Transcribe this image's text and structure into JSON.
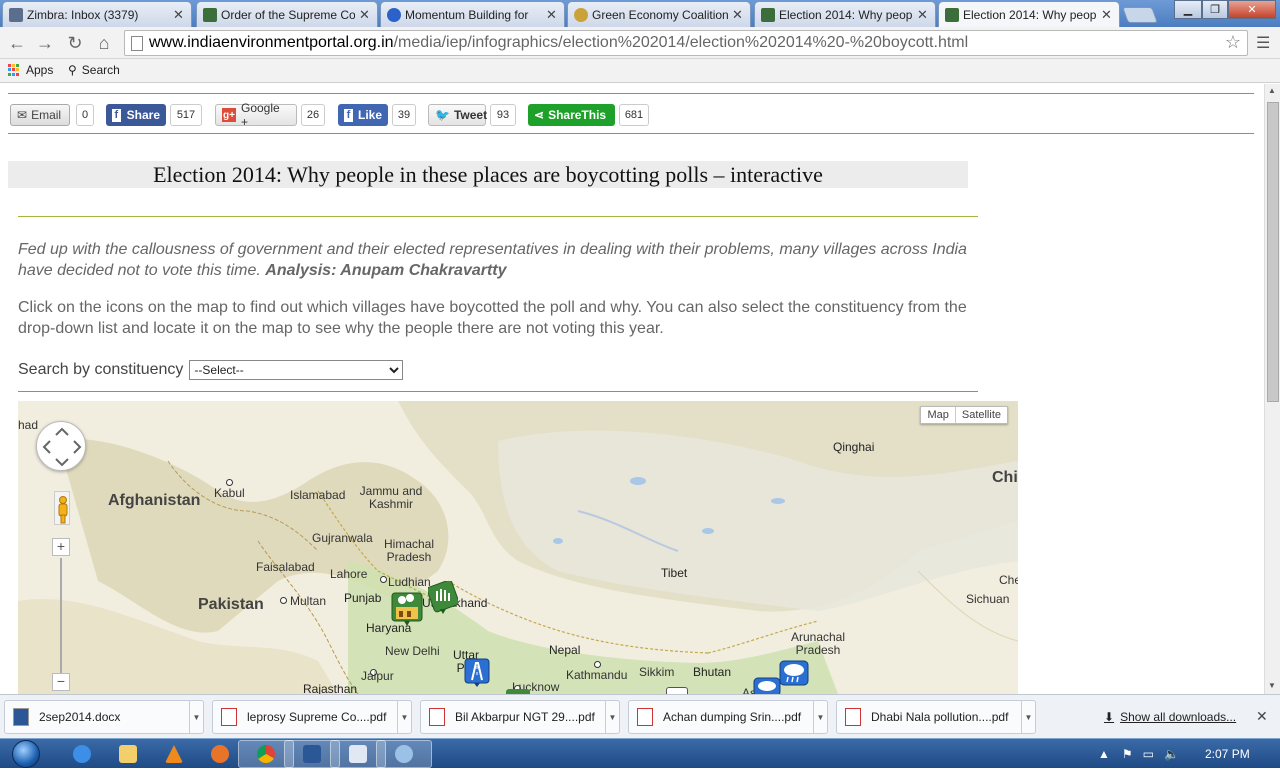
{
  "browser": {
    "tabs": [
      {
        "label": "Zimbra: Inbox (3379)",
        "favicon_color": "#5b6f8c"
      },
      {
        "label": "Order of the Supreme Co",
        "favicon_color": "#3b6e3b"
      },
      {
        "label": "Momentum Building for",
        "favicon_color": "#2a62c9"
      },
      {
        "label": "Green Economy Coalition",
        "favicon_color": "#c9a23a"
      },
      {
        "label": "Election 2014: Why peop",
        "favicon_color": "#3b6e3b"
      },
      {
        "label": "Election 2014: Why peopl",
        "favicon_color": "#3b6e3b"
      }
    ],
    "active_tab": 5,
    "url_host": "www.indiaenvironmentportal.org.in",
    "url_path": "/media/iep/infographics/election%202014/election%202014%20-%20boycott.html",
    "bookmarks": [
      {
        "label": "Apps",
        "icon": "apps-grid-icon"
      },
      {
        "label": "Search",
        "icon": "search-icon"
      }
    ]
  },
  "share_bar": {
    "email_label": "Email",
    "email_count": "0",
    "facebook_label": "Share",
    "facebook_count": "517",
    "google_label": "Google +",
    "google_count": "26",
    "like_label": "Like",
    "like_count": "39",
    "tweet_label": "Tweet",
    "tweet_count": "93",
    "sharethis_label": "ShareThis",
    "sharethis_count": "681"
  },
  "article": {
    "title": "Election 2014: Why people in these places are boycotting polls – interactive",
    "intro": "Fed up with the callousness of government and their elected representatives in dealing with their problems, many villages across India have decided not to vote this time.",
    "analysis": "Analysis: Anupam Chakravartty",
    "instructions": "Click on the icons on the map to find out which villages have boycotted the poll and why. You can also select the constituency from the drop-down list and locate it on the map to see why the people there are not voting this year.",
    "search_label": "Search by constituency",
    "select_value": "--Select--"
  },
  "map": {
    "map_type_buttons": [
      "Map",
      "Satellite"
    ],
    "labels": {
      "afghanistan": "Afghanistan",
      "pakistan": "Pakistan",
      "tibet": "Tibet",
      "qinghai": "Qinghai",
      "chi": "Chi",
      "kabul": "Kabul",
      "islamabad": "Islamabad",
      "jammu_kashmir": "Jammu and Kashmir",
      "gujranwala": "Gujranwala",
      "himachal": "Himachal Pradesh",
      "faisalabad": "Faisalabad",
      "lahore": "Lahore",
      "ludhiana": "Ludhian",
      "multan": "Multan",
      "punjab": "Punjab",
      "uttarakhand": "Uttarakhand",
      "haryana": "Haryana",
      "new_delhi": "New Delhi",
      "jaipur": "Jaipur",
      "uttar_pradesh": "Uttar Pra",
      "lucknow": "Lucknow",
      "rajasthan": "Rajasthan",
      "nepal": "Nepal",
      "kathmandu": "Kathmandu",
      "sikkim": "Sikkim",
      "bhutan": "Bhutan",
      "arunachal": "Arunachal Pradesh",
      "sichuan": "Sichuan",
      "che": "Che",
      "had": "had",
      "as": "As"
    }
  },
  "downloads": {
    "items": [
      {
        "label": "2sep2014.docx",
        "type": "word"
      },
      {
        "label": "leprosy Supreme Co....pdf",
        "type": "pdf"
      },
      {
        "label": "Bil Akbarpur NGT 29....pdf",
        "type": "pdf"
      },
      {
        "label": "Achan dumping Srin....pdf",
        "type": "pdf"
      },
      {
        "label": "Dhabi Nala pollution....pdf",
        "type": "pdf"
      }
    ],
    "show_all": "Show all downloads..."
  },
  "taskbar": {
    "clock": "2:07 PM"
  }
}
